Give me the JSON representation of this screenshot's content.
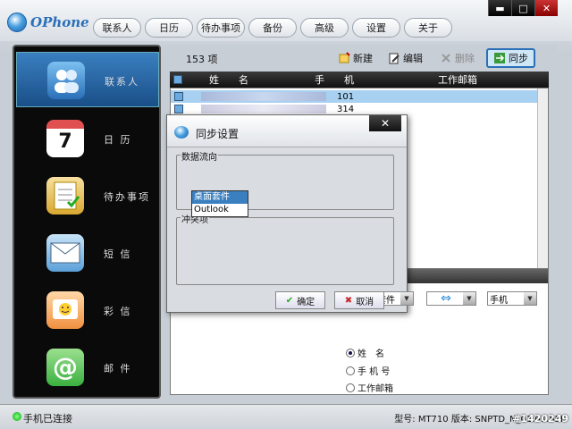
{
  "app": {
    "logo_text": "OPhone"
  },
  "topnav": [
    "联系人",
    "日历",
    "待办事项",
    "备份",
    "高级",
    "设置",
    "关于"
  ],
  "window_controls": [
    "▬",
    "□",
    "✕"
  ],
  "sidebar": [
    {
      "label": "联系人",
      "icon": "contacts-icon",
      "color": "#3a8ad8"
    },
    {
      "label": "日 历",
      "icon": "calendar-icon",
      "color": "#e05050"
    },
    {
      "label": "待办事项",
      "icon": "todo-icon",
      "color": "#d8a830"
    },
    {
      "label": "短 信",
      "icon": "sms-icon",
      "color": "#5aa0d8"
    },
    {
      "label": "彩 信",
      "icon": "mms-icon",
      "color": "#f09040"
    },
    {
      "label": "邮 件",
      "icon": "email-icon",
      "color": "#3ab040"
    }
  ],
  "calendar_day": "7",
  "toolbar": {
    "count": "153 项",
    "new": "新建",
    "edit": "编辑",
    "delete": "删除",
    "sync": "同步"
  },
  "table": {
    "headers": [
      "姓　　名",
      "手　　机",
      "工作邮箱"
    ],
    "rows": [
      {
        "phone": "101"
      },
      {
        "phone": "314"
      }
    ]
  },
  "dialog": {
    "title": "同步设置",
    "close": "✕",
    "data_direction_label": "数据流向",
    "source_combo": "桌面套件",
    "direction_symbol": "⇔",
    "target_combo": "手机",
    "dropdown_options": [
      "桌面套件",
      "Outlook"
    ],
    "conflict_label": "冲突项",
    "radios": [
      {
        "label": "姓　名",
        "checked": true
      },
      {
        "label": "手 机 号",
        "checked": false
      },
      {
        "label": "工作邮箱",
        "checked": false
      }
    ],
    "ok": "确定",
    "cancel": "取消"
  },
  "status": {
    "connected": "手机已连接",
    "version": "型号: MT710 版本: SNPTD_N_01.01.55I"
  },
  "watermark": "#1420249"
}
